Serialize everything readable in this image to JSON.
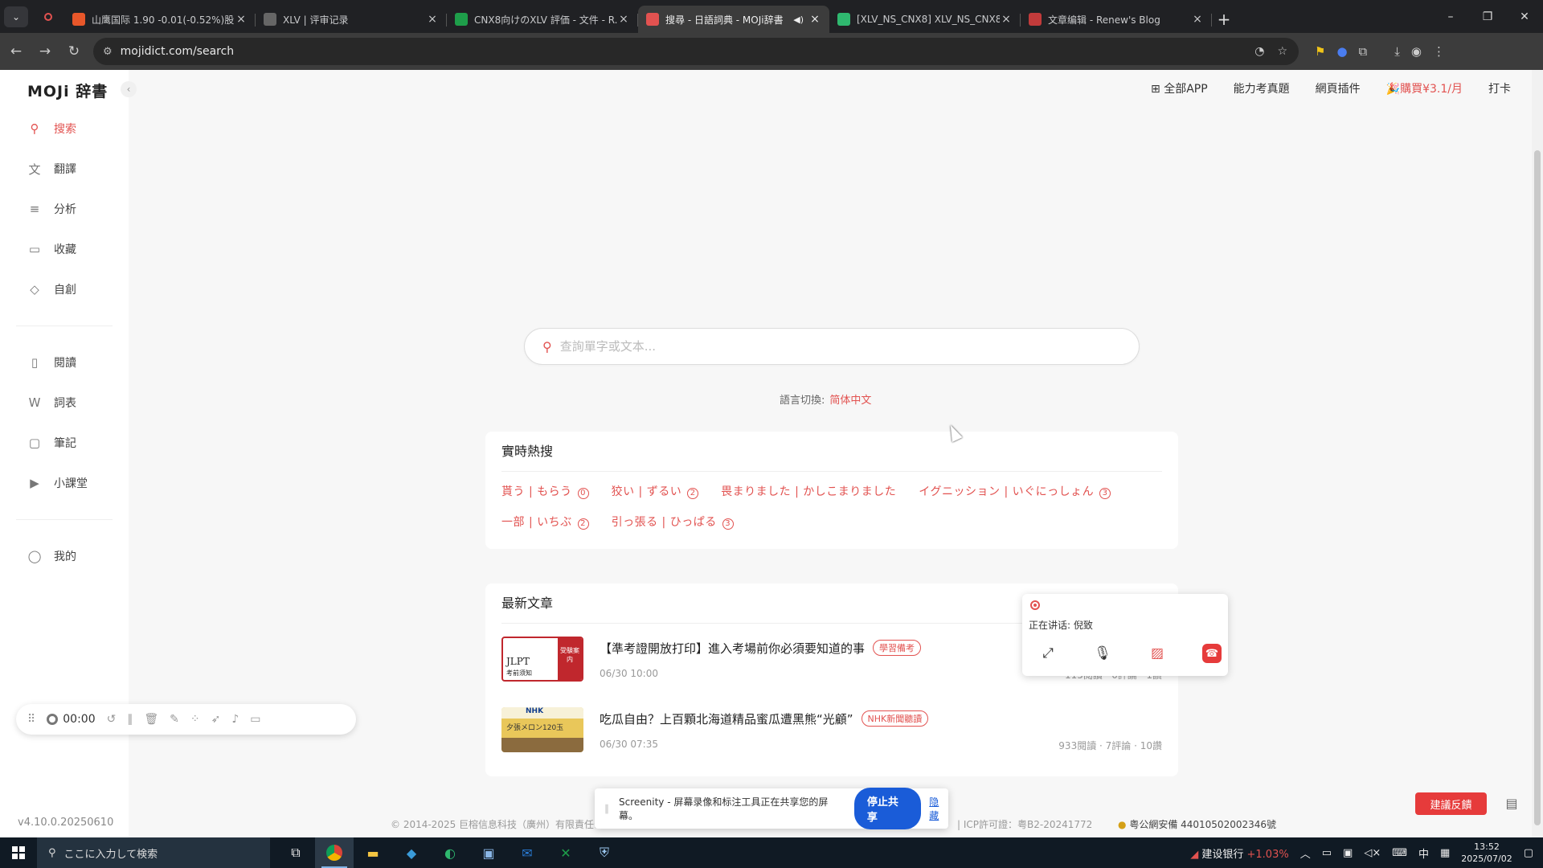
{
  "browser": {
    "tabs": [
      {
        "title": "山鹰国际 1.90 -0.01(-0.52%)股...",
        "favicon_color": "#e8572a",
        "active": false
      },
      {
        "title": "XLV | 评审记录",
        "favicon_color": "#666666",
        "active": false
      },
      {
        "title": "CNX8向けのXLV 評価 - 文件 - R...",
        "favicon_color": "#1e9e4a",
        "active": false
      },
      {
        "title": "搜尋 - 日語詞典 - MOJi辞書",
        "favicon_color": "#e25250",
        "active": true
      },
      {
        "title": "[XLV_NS_CNX8] XLV_NS_CNX8...",
        "favicon_color": "#2fb86f",
        "active": false
      },
      {
        "title": "文章编辑 - Renew's Blog",
        "favicon_color": "#c23b3b",
        "active": false
      }
    ],
    "url": "mojidict.com/search"
  },
  "app": {
    "logo": "MOJi 辞書",
    "version": "v4.10.0.20250610",
    "nav": [
      {
        "label": "搜索",
        "icon": "search-icon",
        "active": true
      },
      {
        "label": "翻譯",
        "icon": "translate-icon"
      },
      {
        "label": "分析",
        "icon": "analyze-icon"
      },
      {
        "label": "收藏",
        "icon": "folder-icon"
      },
      {
        "label": "自創",
        "icon": "diamond-icon"
      }
    ],
    "nav2": [
      {
        "label": "閱讀",
        "icon": "book-icon"
      },
      {
        "label": "詞表",
        "icon": "wordlist-icon"
      },
      {
        "label": "筆記",
        "icon": "note-icon"
      },
      {
        "label": "小課堂",
        "icon": "class-icon"
      }
    ],
    "nav3": [
      {
        "label": "我的",
        "icon": "user-icon"
      }
    ],
    "topnav": {
      "all_apps": "全部APP",
      "exam": "能力考真題",
      "plugin": "網頁插件",
      "buy": "購買¥3.1/月",
      "checkin": "打卡"
    },
    "search": {
      "placeholder": "查詢單字或文本..."
    },
    "language": {
      "label": "語言切換:",
      "value": "简体中文"
    },
    "hot": {
      "title": "實時熱搜",
      "items": [
        {
          "text": "貰う | もらう",
          "n": "0"
        },
        {
          "text": "狡い | ずるい",
          "n": "2"
        },
        {
          "text": "畏まりました | かしこまりました",
          "n": ""
        },
        {
          "text": "イグニッション | いぐにっしょん",
          "n": "3"
        },
        {
          "text": "一部 | いちぶ",
          "n": "2"
        },
        {
          "text": "引っ張る | ひっぱる",
          "n": "3"
        }
      ]
    },
    "news": {
      "title": "最新文章",
      "articles": [
        {
          "title": "【準考證開放打印】進入考場前你必須要知道的事",
          "tag": "學習備考",
          "date": "06/30 10:00",
          "stats": "115閱讀 · 0評論 · 1讚",
          "thumb_a": "JLPT",
          "thumb_b": "考前须知",
          "thumb_c": "受験案内"
        },
        {
          "title": "吃瓜自由？上百顆北海道精品蜜瓜遭黑熊“光顧”",
          "tag": "NHK新聞聽讀",
          "date": "06/30 07:35",
          "stats": "933閱讀 · 7評論 · 10讚",
          "thumb_a": "NHK",
          "thumb_b": "夕張メロン120玉"
        }
      ]
    },
    "footer": {
      "copyright": "© 2014-2025 巨榕信息科技（廣州）有限責任公司",
      "icp": "| ICP許可證：粤B2-20241772",
      "police": "粤公網安備 44010502002346號"
    },
    "feedback": "建議反饋"
  },
  "recorder": {
    "time": "00:00"
  },
  "meeting": {
    "speaking": "正在讲话: 倪致"
  },
  "share": {
    "text": "Screenity - 屏幕录像和标注工具正在共享您的屏幕。",
    "stop": "停止共享",
    "hide": "隐藏"
  },
  "taskbar": {
    "search_placeholder": "ここに入力して検索",
    "stock": "建设银行",
    "stock_change": "+1.03%",
    "ime": "中",
    "time": "13:52",
    "date": "2025/07/02"
  }
}
